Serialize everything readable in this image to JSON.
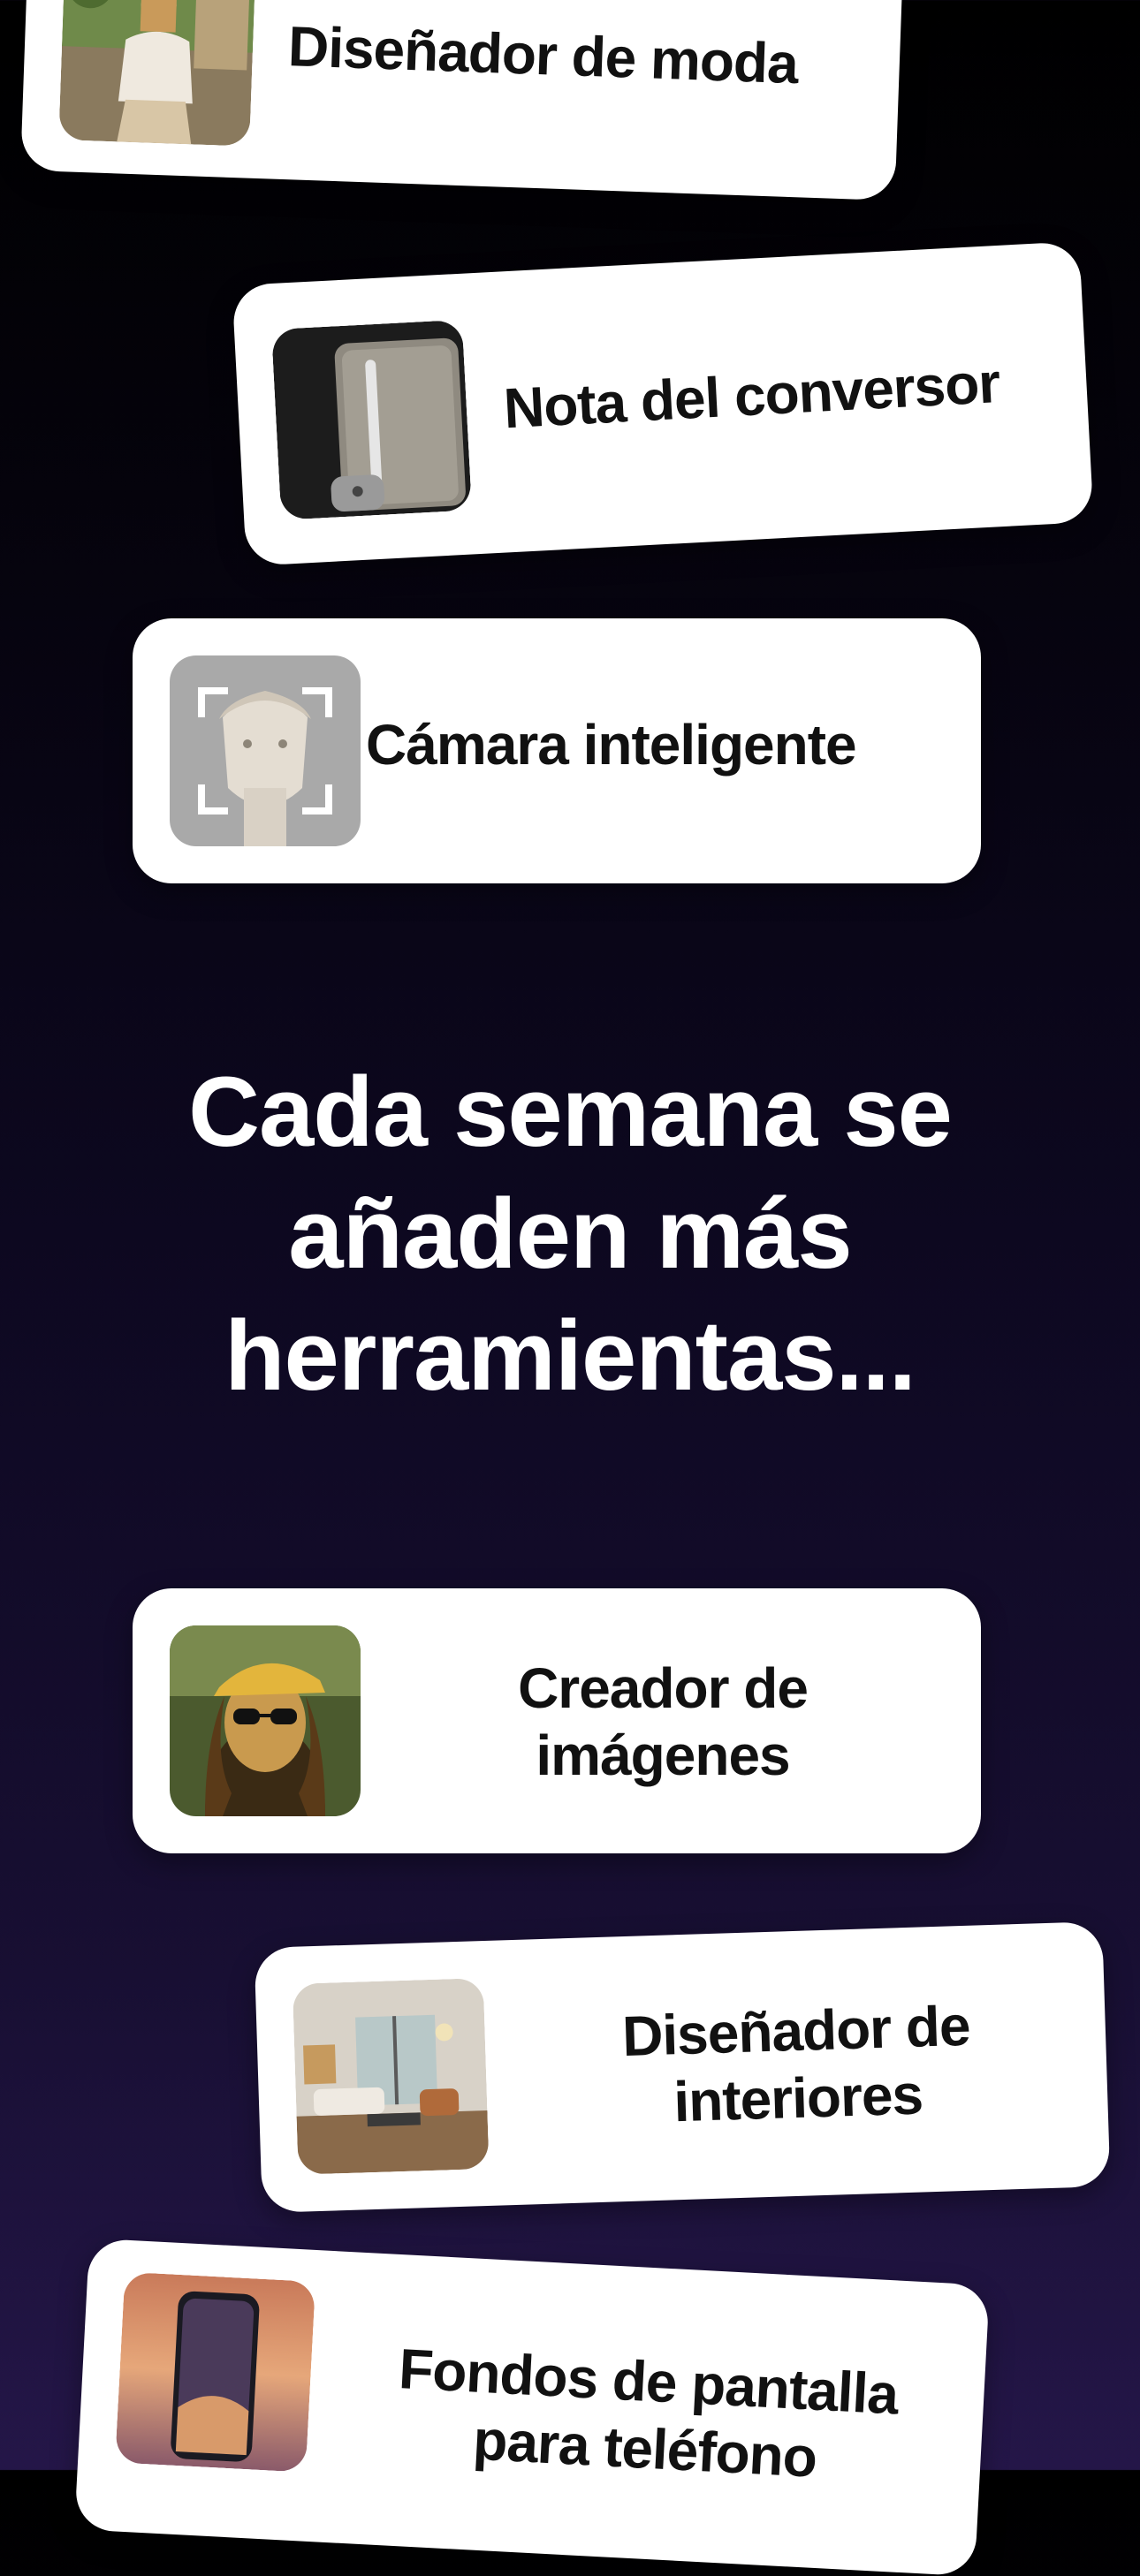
{
  "cards": {
    "fashion": {
      "label": "Diseñador de moda",
      "icon": "fashion-photo-icon"
    },
    "converter": {
      "label": "Nota del conversor",
      "icon": "notebook-pen-icon"
    },
    "camera": {
      "label": "Cámara inteligente",
      "icon": "statue-scan-icon"
    },
    "image_creator": {
      "label_line1": "Creador de",
      "label_line2": "imágenes",
      "icon": "mona-lisa-sunglasses-icon"
    },
    "interior": {
      "label_line1": "Diseñador de",
      "label_line2": "interiores",
      "icon": "living-room-icon"
    },
    "wallpapers": {
      "label_line1": "Fondos de pantalla",
      "label_line2": "para teléfono",
      "icon": "phone-wallpaper-icon"
    }
  },
  "headline": {
    "line1": "Cada semana se",
    "line2": "añaden más",
    "line3": "herramientas..."
  },
  "colors": {
    "background_top": "#000000",
    "background_bottom": "#241648",
    "card": "#ffffff",
    "text_dark": "#111111",
    "text_light": "#ffffff"
  }
}
